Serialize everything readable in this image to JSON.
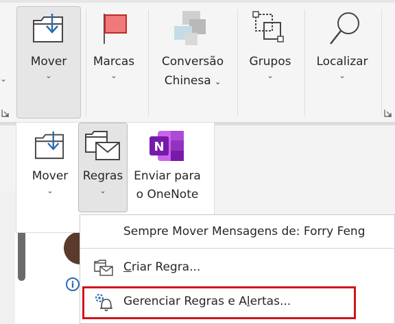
{
  "ribbon": {
    "buttons": [
      {
        "label": "Mover"
      },
      {
        "label": "Marcas"
      },
      {
        "label_line1": "Conversão",
        "label_line2": "Chinesa"
      },
      {
        "label": "Grupos"
      },
      {
        "label": "Localizar"
      }
    ],
    "chevron": "⌄"
  },
  "move_panel": {
    "mover_label": "Mover",
    "regras_label": "Regras",
    "onenote_line1": "Enviar para",
    "onenote_line2": "o OneNote"
  },
  "rules_menu": {
    "always_move": "Sempre Mover Mensagens de: Forry Feng",
    "create_rule_prefix": "C",
    "create_rule_rest": "riar Regra...",
    "manage_prefix": "Gerenciar Regras e A",
    "manage_underlined": "l",
    "manage_rest": "ertas..."
  },
  "icons": {
    "mover": "move-to-folder-icon",
    "marcas": "flag-icon",
    "conversao": "chinese-conversion-icon",
    "grupos": "groups-icon",
    "localizar": "search-icon",
    "regras": "rules-icon",
    "onenote": "onenote-icon",
    "criar_regra": "create-rule-icon",
    "gerenciar": "manage-rules-alerts-icon"
  },
  "colors": {
    "highlight": "#d0131b",
    "onenote": "#7719aa",
    "flag": "#e84f4f",
    "accent": "#2b6ab0"
  }
}
